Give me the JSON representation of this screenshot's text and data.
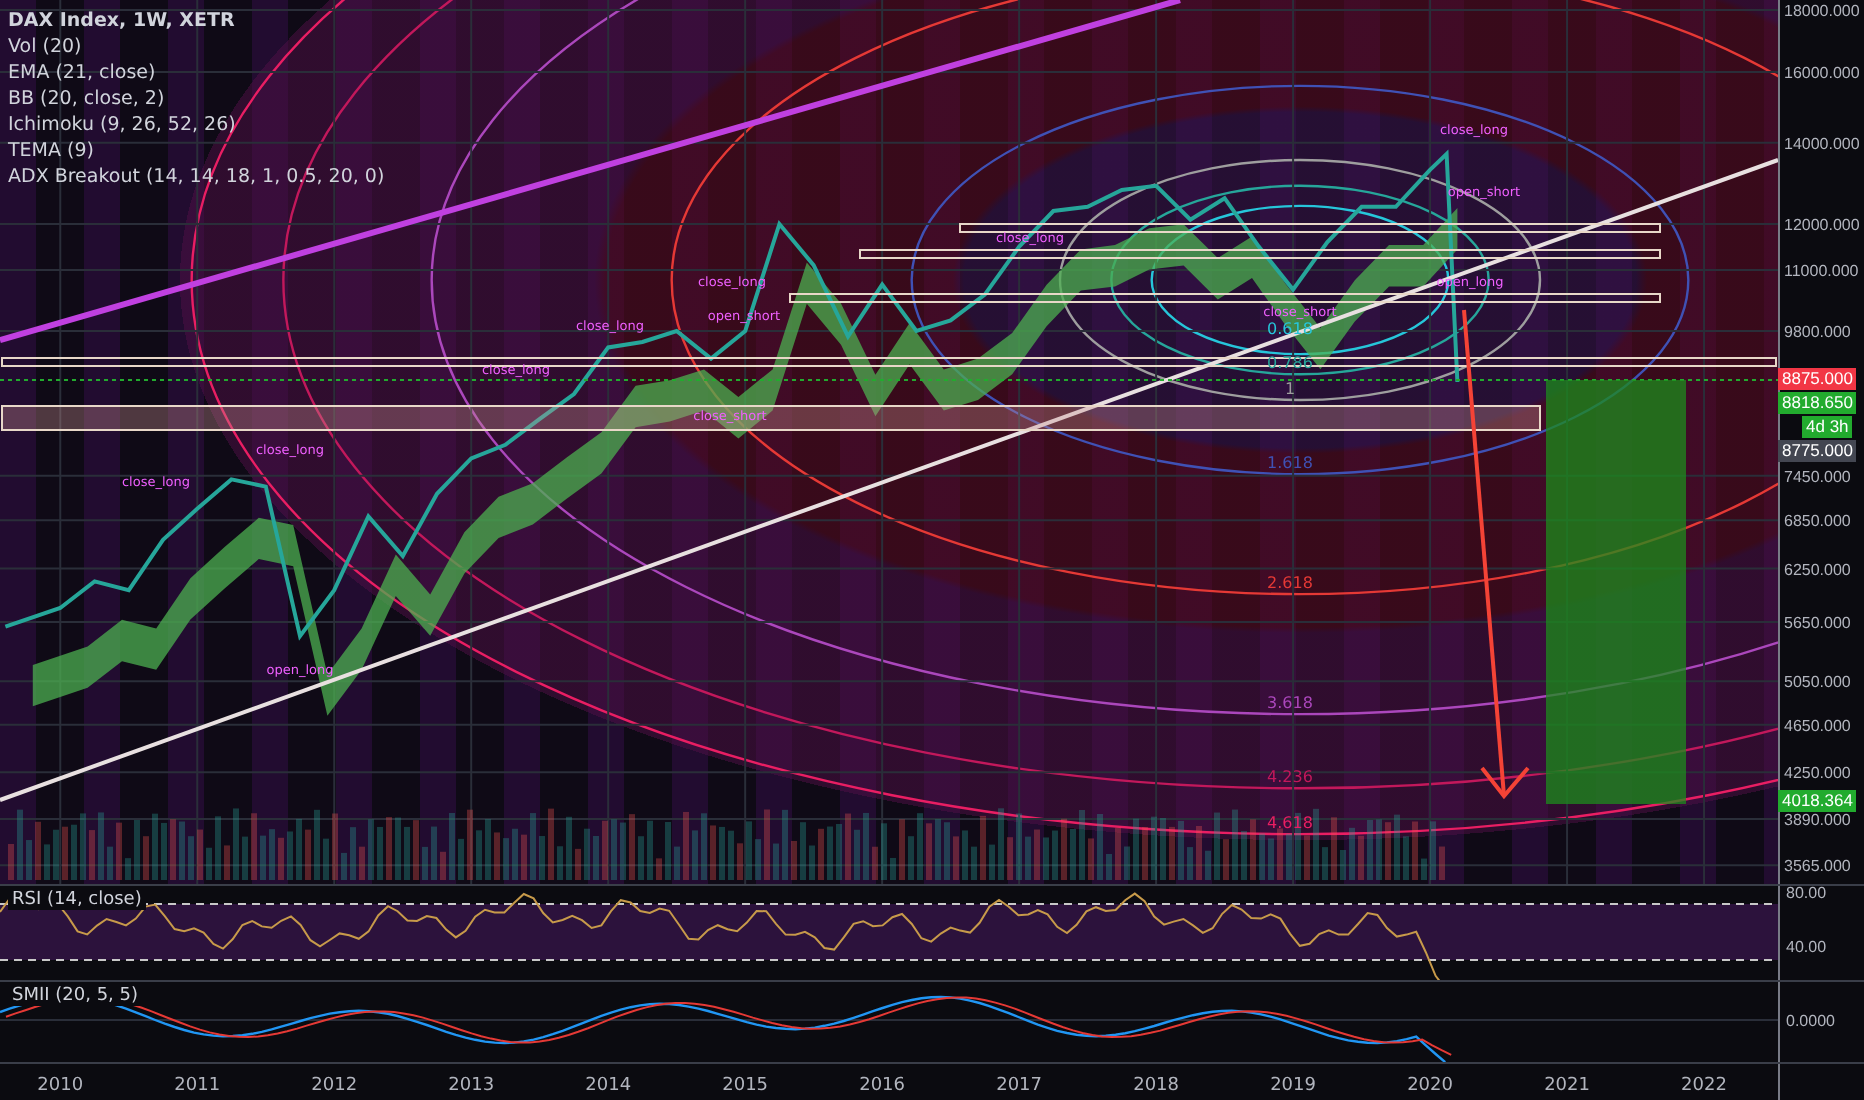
{
  "legend": [
    "DAX Index, 1W, XETR",
    "Vol (20)",
    "EMA (21, close)",
    "BB (20, close, 2)",
    "Ichimoku (9, 26, 52, 26)",
    "TEMA (9)",
    "ADX Breakout (14, 14, 18, 1, 0.5, 20, 0)"
  ],
  "price_chart": {
    "axis_labels": [
      "18000.000",
      "16000.000",
      "14000.000",
      "12000.000",
      "11000.000",
      "9800.000",
      "7450.000",
      "6850.000",
      "6250.000",
      "5650.000",
      "5050.000",
      "4650.000",
      "4250.000",
      "3890.000",
      "3565.000"
    ],
    "signal_labels": [
      "close_long",
      "close_long",
      "close_long",
      "close_long",
      "close_long",
      "open_short",
      "close_short",
      "close_long",
      "close_long",
      "open_short",
      "open_long",
      "close_short",
      "open_long"
    ],
    "fib_levels": [
      "0.618",
      "0.786",
      "1",
      "1.618",
      "2.618",
      "3.618",
      "4.236",
      "4.618"
    ],
    "price_tags": [
      {
        "text": "8875.000",
        "color": "#f23645"
      },
      {
        "text": "8818.650",
        "color": "#22ab2e"
      },
      {
        "text": "4d 3h",
        "color": "#22ab2e"
      },
      {
        "text": "8775.000",
        "color": "#434651"
      }
    ],
    "low_tag": {
      "text": "4018.364",
      "color": "#22ab2e"
    }
  },
  "rsi": {
    "title": "RSI (14, close)",
    "axis_labels": [
      "80.00",
      "40.00"
    ]
  },
  "smii": {
    "title": "SMII (20, 5, 5)",
    "axis_label": "0.0000"
  },
  "time_axis": [
    "2010",
    "2011",
    "2012",
    "2013",
    "2014",
    "2015",
    "2016",
    "2017",
    "2018",
    "2019",
    "2020",
    "2021",
    "2022"
  ]
}
